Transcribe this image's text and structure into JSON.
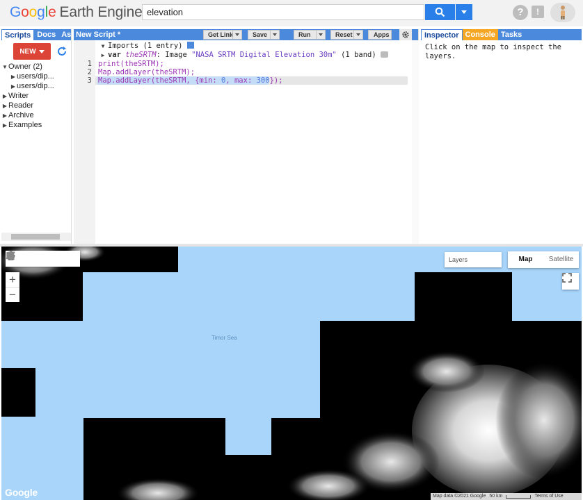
{
  "header": {
    "logo": {
      "part1": "G",
      "part2": "o",
      "part3": "o",
      "part4": "g",
      "part5": "l",
      "part6": "e",
      "product": "Earth Engine"
    },
    "search_value": "elevation",
    "help_label": "?",
    "feedback_label": "!"
  },
  "left_panel": {
    "tabs": [
      "Scripts",
      "Docs",
      "Ass"
    ],
    "new_button": "NEW",
    "tree": [
      {
        "label": "Owner (2)",
        "expanded": true
      },
      {
        "label": "users/dip...",
        "child": true
      },
      {
        "label": "users/dip...",
        "child": true
      },
      {
        "label": "Writer",
        "expanded": false
      },
      {
        "label": "Reader",
        "expanded": false
      },
      {
        "label": "Archive",
        "expanded": false
      },
      {
        "label": "Examples",
        "expanded": false
      }
    ]
  },
  "editor": {
    "title": "New Script *",
    "buttons": {
      "get_link": "Get Link",
      "save": "Save",
      "run": "Run",
      "reset": "Reset",
      "apps": "Apps"
    },
    "imports_label": "Imports (1 entry)",
    "import_line": {
      "kw": "var",
      "name": "theSRTM",
      "type": "Image",
      "desc": "\"NASA SRTM Digital Elevation 30m\"",
      "bands": "(1 band)"
    },
    "lines": [
      {
        "no": "1",
        "text": "print(theSRTM);"
      },
      {
        "no": "2",
        "text": "Map.addLayer(theSRTM);"
      },
      {
        "no": "3",
        "text": "Map.addLayer(theSRTM, {min: 0, max: 300});"
      }
    ]
  },
  "inspector": {
    "tabs": [
      "Inspector",
      "Console",
      "Tasks"
    ],
    "message": "Click on the map to inspect the layers."
  },
  "map": {
    "layers_label": "Layers",
    "map_type": [
      "Map",
      "Satellite"
    ],
    "sea_label": "Timor Sea",
    "google_logo": "Google",
    "attribution": {
      "data": "Map data ©2021 Google",
      "scale": "50 km",
      "terms": "Terms of Use"
    },
    "colors": {
      "water": "#a9d5fb",
      "nodata": "#000000"
    }
  }
}
